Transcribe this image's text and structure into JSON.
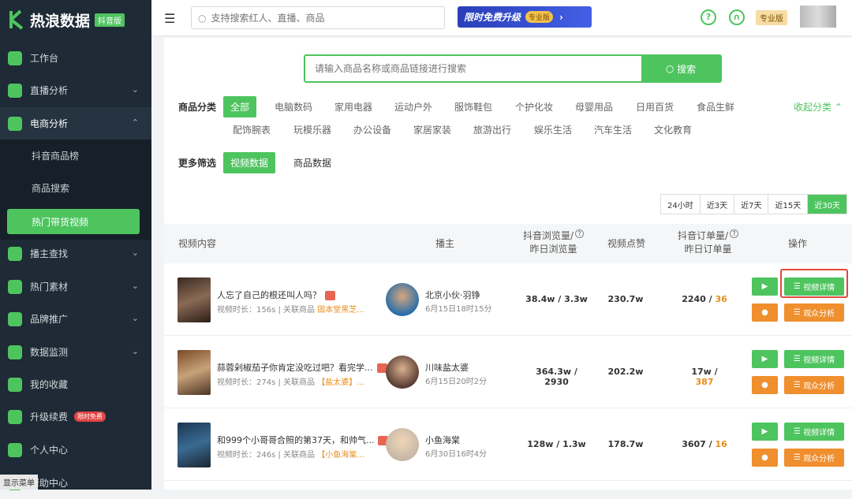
{
  "app": {
    "title": "热浪数据",
    "version": "抖音版"
  },
  "sidebar": {
    "items": [
      {
        "label": "工作台"
      },
      {
        "label": "直播分析"
      },
      {
        "label": "电商分析"
      },
      {
        "label": "播主查找"
      },
      {
        "label": "热门素材"
      },
      {
        "label": "品牌推广"
      },
      {
        "label": "数据监测"
      },
      {
        "label": "我的收藏"
      },
      {
        "label": "升级续费",
        "badge": "限时免费"
      },
      {
        "label": "个人中心"
      },
      {
        "label": "帮助中心"
      }
    ],
    "sub_items": [
      {
        "label": "抖音商品榜"
      },
      {
        "label": "商品搜索"
      },
      {
        "label": "热门带货视频"
      }
    ],
    "show_menu": "显示菜单"
  },
  "topbar": {
    "search_placeholder": "支持搜索红人、直播、商品",
    "promo_text": "限时免费升级",
    "promo_badge": "专业版",
    "pro_label": "专业版"
  },
  "main": {
    "search_placeholder": "请输入商品名称或商品链接进行搜索",
    "search_button": "搜索",
    "category_label": "商品分类",
    "categories": [
      "全部",
      "电脑数码",
      "家用电器",
      "运动户外",
      "服饰鞋包",
      "个护化妆",
      "母婴用品",
      "日用百货",
      "食品生鲜",
      "配饰腕表",
      "玩模乐器",
      "办公设备",
      "家居家装",
      "旅游出行",
      "娱乐生活",
      "汽车生活",
      "文化教育"
    ],
    "collapse_label": "收起分类",
    "more_filter_label": "更多筛选",
    "filters": [
      "视频数据",
      "商品数据"
    ],
    "time_tabs": [
      "24小时",
      "近3天",
      "近7天",
      "近15天",
      "近30天"
    ],
    "headers": {
      "video": "视频内容",
      "host": "播主",
      "views_1": "抖音浏览量/",
      "views_2": "昨日浏览量",
      "likes": "视频点赞",
      "orders_1": "抖音订单量/",
      "orders_2": "昨日订单量",
      "ops": "操作"
    },
    "buttons": {
      "detail": "视频详情",
      "audience": "观众分析"
    },
    "rows": [
      {
        "title": "人忘了自己的根还叫人吗？",
        "meta": "视频时长：156s | 关联商品",
        "product": "固本堂黑芝...",
        "host": "北京小伙·羽铮",
        "time": "6月15日18时15分",
        "views": "38.4w / 3.3w",
        "likes": "230.7w",
        "orders": "2240 / ",
        "orders_hl": "36"
      },
      {
        "title": "蒜蓉剁椒茄子你肯定没吃过吧？看完学...",
        "meta": "视频时长：274s | 关联商品",
        "product": "【盐太婆】...",
        "host": "川味盐太婆",
        "time": "6月15日20时2分",
        "views": "364.3w / 2930",
        "likes": "202.2w",
        "orders": "17w / ",
        "orders_hl": "387"
      },
      {
        "title": "和999个小哥哥合照的第37天，和帅气...",
        "meta": "视频时长：246s | 关联商品",
        "product": "【小鱼海棠...",
        "host": "小鱼海棠",
        "time": "6月30日16时4分",
        "views": "128w / 1.3w",
        "likes": "178.7w",
        "orders": "3607 / ",
        "orders_hl": "16"
      }
    ]
  },
  "colors": {
    "accent": "#4ec45f",
    "orange": "#ef8f2e",
    "sidebar": "#1e2a35"
  }
}
